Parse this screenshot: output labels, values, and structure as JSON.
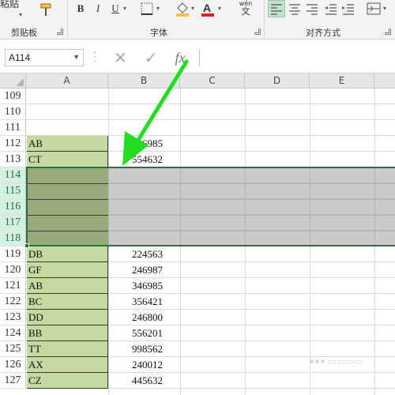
{
  "ribbon": {
    "paste_label": "粘贴",
    "clipboard_label": "剪贴板",
    "font_label": "字体",
    "alignment_label": "对齐方式",
    "bold": "B",
    "italic": "I",
    "underline": "U",
    "phonetic": "wén",
    "phonetic_char": "文"
  },
  "formula_bar": {
    "name_box": "A114",
    "formula": "",
    "fx_label": "fx"
  },
  "columns": [
    "A",
    "B",
    "C",
    "D",
    "E"
  ],
  "rows": [
    {
      "num": "109",
      "a": "",
      "b": "",
      "filled": false
    },
    {
      "num": "110",
      "a": "",
      "b": "",
      "filled": false
    },
    {
      "num": "111",
      "a": "",
      "b": "",
      "filled": false
    },
    {
      "num": "112",
      "a": "AB",
      "b": "346985",
      "filled": true
    },
    {
      "num": "113",
      "a": "CT",
      "b": "554632",
      "filled": true
    },
    {
      "num": "114",
      "a": "",
      "b": "",
      "filled": true,
      "selected": true
    },
    {
      "num": "115",
      "a": "",
      "b": "",
      "filled": true,
      "selected": true
    },
    {
      "num": "116",
      "a": "",
      "b": "",
      "filled": true,
      "selected": true
    },
    {
      "num": "117",
      "a": "",
      "b": "",
      "filled": true,
      "selected": true
    },
    {
      "num": "118",
      "a": "",
      "b": "",
      "filled": true,
      "selected": true
    },
    {
      "num": "119",
      "a": "DB",
      "b": "224563",
      "filled": true
    },
    {
      "num": "120",
      "a": "GF",
      "b": "246987",
      "filled": true
    },
    {
      "num": "121",
      "a": "AB",
      "b": "346985",
      "filled": true
    },
    {
      "num": "122",
      "a": "BC",
      "b": "356421",
      "filled": true
    },
    {
      "num": "123",
      "a": "DD",
      "b": "246800",
      "filled": true
    },
    {
      "num": "124",
      "a": "BB",
      "b": "556201",
      "filled": true
    },
    {
      "num": "125",
      "a": "TT",
      "b": "998562",
      "filled": true
    },
    {
      "num": "126",
      "a": "AX",
      "b": "240012",
      "filled": true
    },
    {
      "num": "127",
      "a": "CZ",
      "b": "445632",
      "filled": true
    }
  ],
  "colors": {
    "accent": "#217346",
    "cell_fill": "#c5d9a0",
    "selection": "#a6a6a6",
    "arrow": "#22dd22"
  }
}
